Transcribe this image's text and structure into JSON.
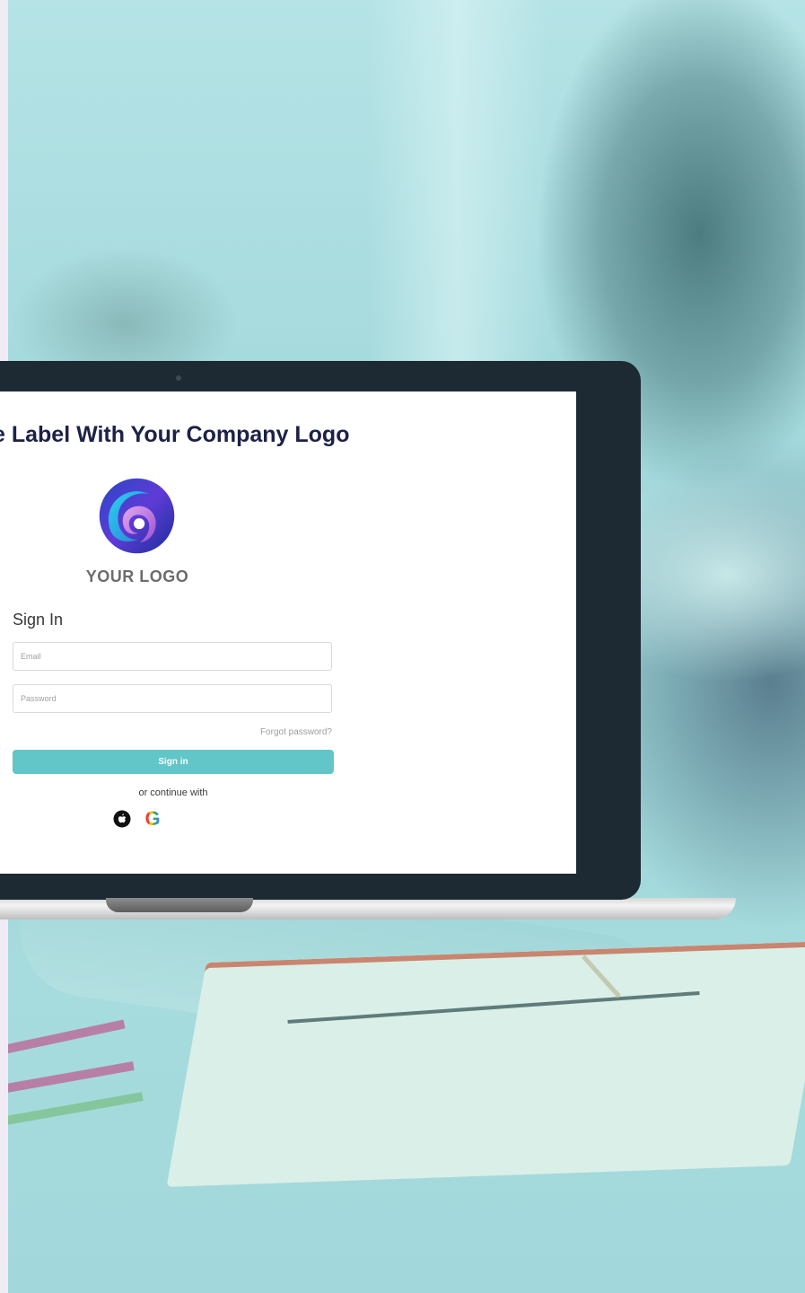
{
  "headline": "e Label With Your Company Logo",
  "logo": {
    "text": "YOUR LOGO",
    "icon": "swirl-logo-icon"
  },
  "signin": {
    "title": "Sign In",
    "email_placeholder": "Email",
    "password_placeholder": "Password",
    "forgot_label": "Forgot password?",
    "button_label": "Sign in",
    "continue_label": "or continue with",
    "providers": [
      {
        "name": "apple",
        "icon": "apple-icon"
      },
      {
        "name": "google",
        "icon": "google-icon",
        "glyph": "G"
      }
    ]
  },
  "colors": {
    "accent": "#62c6c8",
    "headline": "#1d2146",
    "teal_overlay": "#a5dadd",
    "bezel": "#1e2a33"
  }
}
